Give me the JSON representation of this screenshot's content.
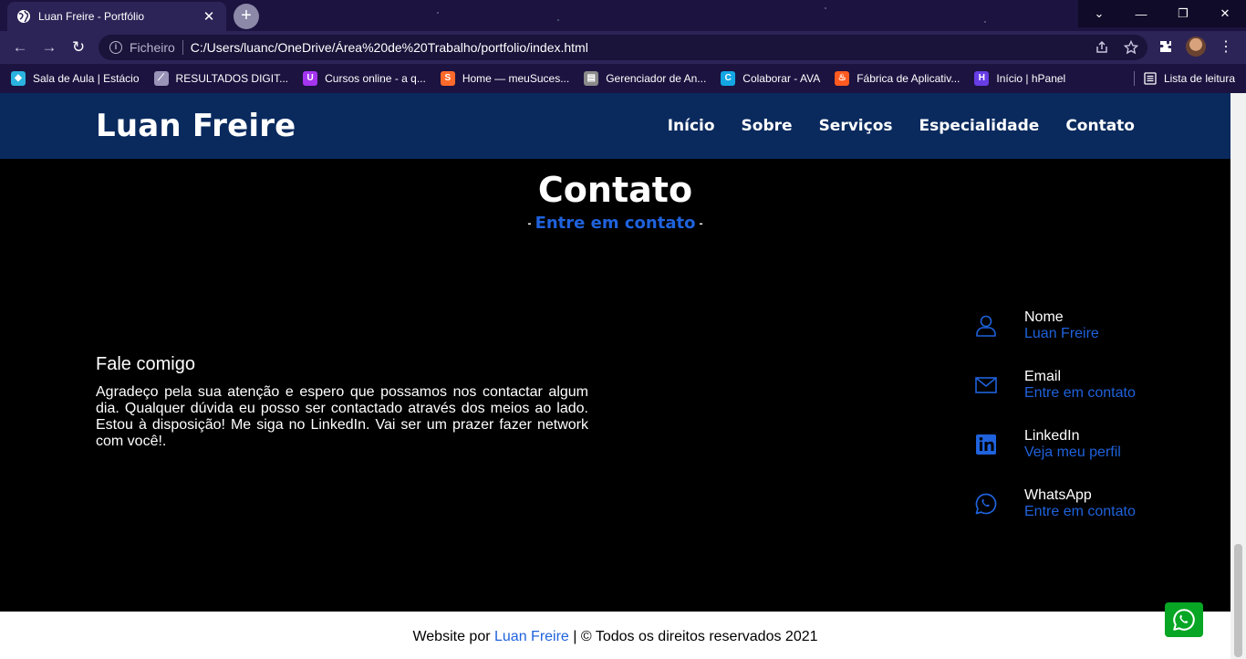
{
  "browser": {
    "tab_title": "Luan Freire - Portfólio",
    "tab_close": "✕",
    "new_tab": "+",
    "window_controls": {
      "dropdown": "⌄",
      "minimize": "—",
      "maximize": "❐",
      "close": "✕"
    },
    "nav": {
      "back": "←",
      "forward": "→",
      "reload": "↻"
    },
    "address": {
      "info": "i",
      "scheme": "Ficheiro",
      "url": "C:/Users/luanc/OneDrive/Área%20de%20Trabalho/portfolio/index.html"
    },
    "bookmarks": [
      {
        "label": "Sala de Aula | Estácio",
        "icon": "diamond-icon",
        "color": "#2bb3e0"
      },
      {
        "label": "RESULTADOS DIGIT...",
        "icon": "chart-icon",
        "color": "#9a93b8"
      },
      {
        "label": "Cursos online - a q...",
        "icon": "udemy-icon",
        "color": "#a435f0"
      },
      {
        "label": "Home — meuSuces...",
        "icon": "s-icon",
        "color": "#ff6a2b"
      },
      {
        "label": "Gerenciador de An...",
        "icon": "doc-icon",
        "color": "#8a8a8a"
      },
      {
        "label": "Colaborar - AVA",
        "icon": "c-icon",
        "color": "#14a6e4"
      },
      {
        "label": "Fábrica de Aplicativ...",
        "icon": "flame-icon",
        "color": "#ff5a1f"
      },
      {
        "label": "Início | hPanel",
        "icon": "h-icon",
        "color": "#673de6"
      }
    ],
    "reading_list": "Lista de leitura"
  },
  "site": {
    "logo": "Luan Freire",
    "menu": [
      "Início",
      "Sobre",
      "Serviços",
      "Especialidade",
      "Contato"
    ]
  },
  "contact_section": {
    "title": "Contato",
    "subtitle": "Entre em contato",
    "talk_title": "Fale comigo",
    "talk_text": "Agradeço pela sua atenção e espero que possamos nos contactar algum dia. Qualquer dúvida eu posso ser contactado através dos meios ao lado. Estou à disposição! Me siga no LinkedIn. Vai ser um prazer fazer network com você!.",
    "items": [
      {
        "label": "Nome",
        "value": "Luan Freire",
        "icon": "user-icon"
      },
      {
        "label": "Email",
        "value": "Entre em contato",
        "icon": "envelope-icon"
      },
      {
        "label": "LinkedIn",
        "value": "Veja meu perfil",
        "icon": "linkedin-icon"
      },
      {
        "label": "WhatsApp",
        "value": "Entre em contato",
        "icon": "whatsapp-icon"
      }
    ]
  },
  "footer": {
    "prefix": "Website por ",
    "author": "Luan Freire",
    "suffix": " | © Todos os direitos reservados 2021"
  },
  "colors": {
    "accent": "#1f62dc",
    "nav_bg": "#0a2a5e",
    "whatsapp": "#07a624"
  }
}
